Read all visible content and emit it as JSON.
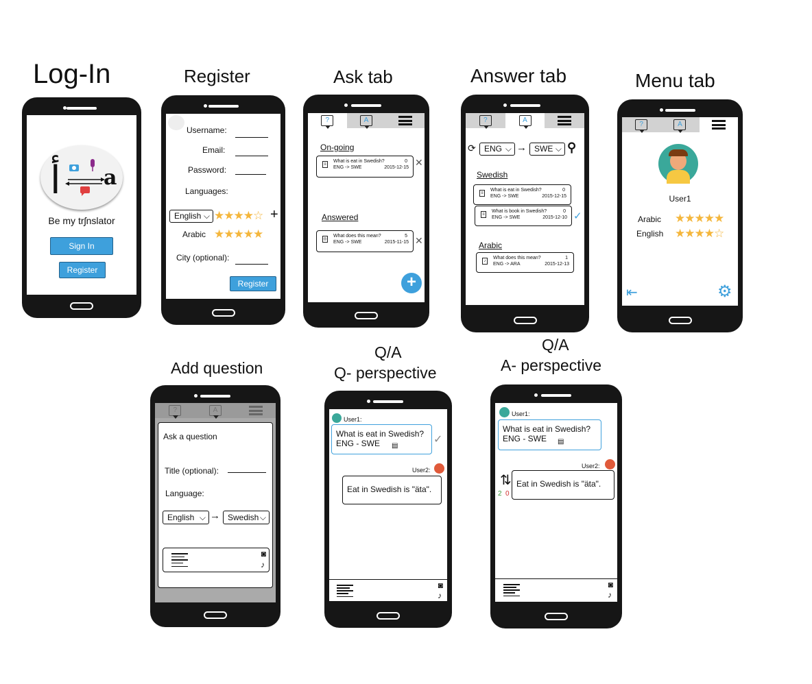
{
  "titles": {
    "login": "Log-In",
    "register": "Register",
    "ask": "Ask tab",
    "answer": "Answer tab",
    "menu": "Menu tab",
    "add": "Add question",
    "qaq_1": "Q/A",
    "qaq_2": "Q- perspective",
    "qaa_1": "Q/A",
    "qaa_2": "A- perspective"
  },
  "login": {
    "tagline": "Be my trʃnslator",
    "logo_latin": "a",
    "sign_in": "Sign In",
    "register": "Register"
  },
  "register": {
    "username": "Username:",
    "email": "Email:",
    "password": "Password:",
    "languages": "Languages:",
    "lang1": "English",
    "lang2": "Arabic",
    "city": "City (optional):",
    "submit": "Register",
    "lang1_rating": "4 of 5",
    "lang2_rating": "5 of 5"
  },
  "ask": {
    "ongoing": "On-going",
    "answered": "Answered",
    "q1": {
      "title": "What is eat in Swedish?",
      "lang": "ENG -> SWE",
      "count": "0",
      "date": "2015-12-15"
    },
    "q2": {
      "title": "What does this mean?",
      "lang": "ENG -> SWE",
      "count": "5",
      "date": "2015-11-15"
    }
  },
  "answer": {
    "from": "ENG",
    "to": "SWE",
    "group1": "Swedish",
    "group2": "Arabic",
    "q1": {
      "title": "What is eat in Swedish?",
      "lang": "ENG -> SWE",
      "count": "0",
      "date": "2015-12-15"
    },
    "q2": {
      "title": "What is book in Swedish?",
      "lang": "ENG -> SWE",
      "count": "0",
      "date": "2015-12-10"
    },
    "q3": {
      "title": "What does this mean?",
      "lang": "ENG -> ARA",
      "count": "1",
      "date": "2015-12-13"
    }
  },
  "menu": {
    "user": "User1",
    "lang1": "Arabic",
    "lang2": "English",
    "lang1_rating": "5 of 5",
    "lang2_rating": "4 of 5"
  },
  "add": {
    "heading": "Ask a question",
    "title_label": "Title (optional):",
    "language_label": "Language:",
    "from": "English",
    "to": "Swedish"
  },
  "qaq": {
    "user1": "User1:",
    "q_line1": "What is eat in Swedish?",
    "q_line2": "ENG - SWE",
    "user2": "User2:",
    "answer": "Eat in Swedish is \"äta\"."
  },
  "qaa": {
    "user1": "User1:",
    "q_line1": "What is eat in Swedish?",
    "q_line2": "ENG - SWE",
    "user2": "User2:",
    "answer": "Eat in Swedish is \"äta\".",
    "up": "2",
    "down": "0"
  },
  "colors": {
    "accent": "#3ea0dc",
    "star": "#f4b63c",
    "phone": "#161616"
  }
}
